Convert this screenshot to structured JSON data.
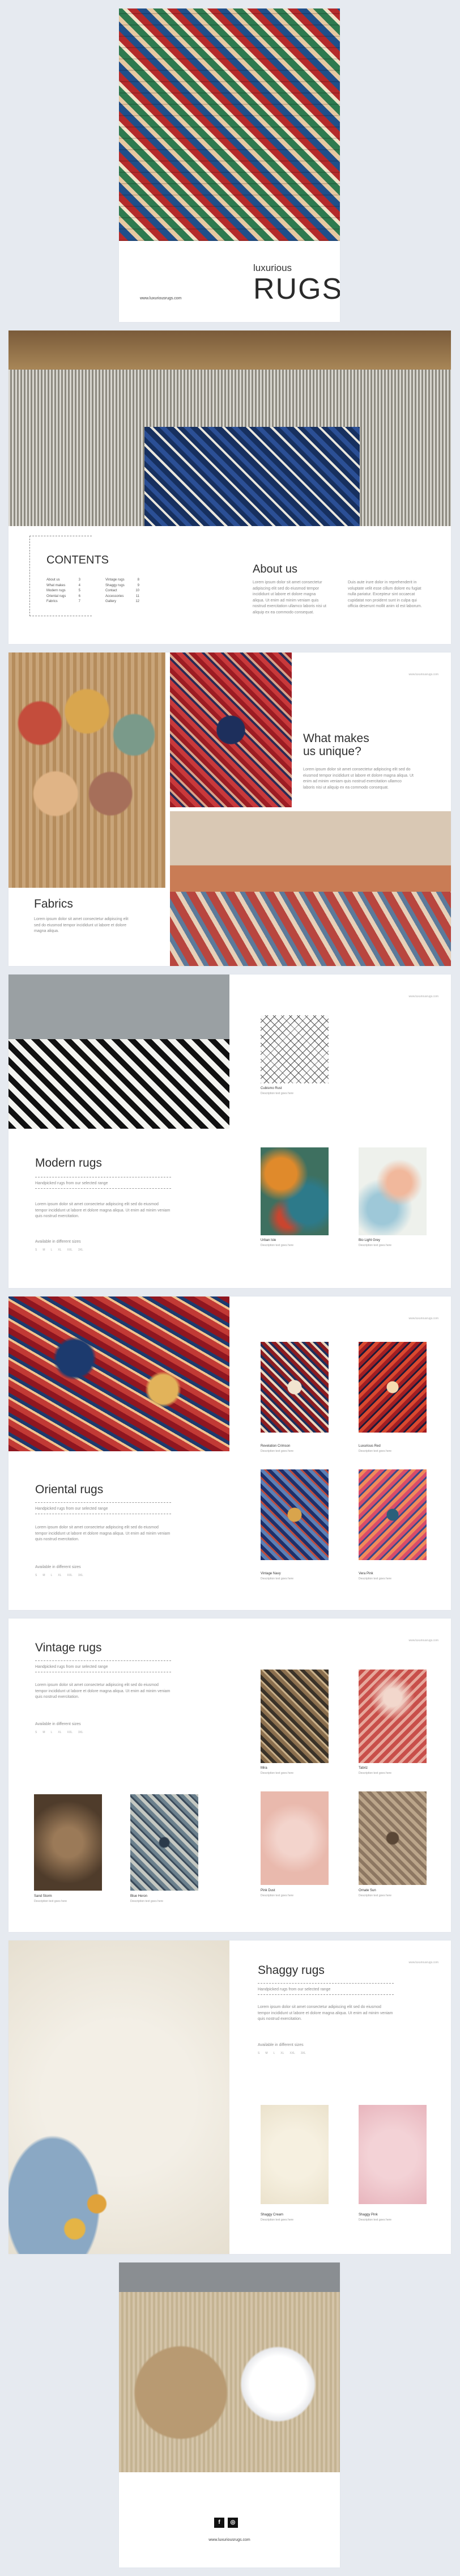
{
  "cover": {
    "title_small": "luxurious",
    "title_big": "RUGS",
    "website": "www.luxuriousrugs.com"
  },
  "contents": {
    "title": "CONTENTS",
    "col1": [
      {
        "label": "About us",
        "page": "3"
      },
      {
        "label": "What makes",
        "page": "4"
      },
      {
        "label": "Modern rugs",
        "page": "5"
      },
      {
        "label": "Oriental rugs",
        "page": "6"
      },
      {
        "label": "Fabrics",
        "page": "7"
      }
    ],
    "col2": [
      {
        "label": "Vintage rugs",
        "page": "8"
      },
      {
        "label": "Shaggy rugs",
        "page": "9"
      },
      {
        "label": "Contact",
        "page": "10"
      },
      {
        "label": "Accessories",
        "page": "11"
      },
      {
        "label": "Gallery",
        "page": "12"
      }
    ]
  },
  "about": {
    "title": "About us",
    "text1": "Lorem ipsum dolor sit amet consectetur adipiscing elit sed do eiusmod tempor incididunt ut labore et dolore magna aliqua. Ut enim ad minim veniam quis nostrud exercitation ullamco laboris nisi ut aliquip ex ea commodo consequat.",
    "text2": "Duis aute irure dolor in reprehenderit in voluptate velit esse cillum dolore eu fugiat nulla pariatur. Excepteur sint occaecat cupidatat non proident sunt in culpa qui officia deserunt mollit anim id est laborum."
  },
  "unique": {
    "title_line1": "What makes",
    "title_line2": "us unique?",
    "text": "Lorem ipsum dolor sit amet consectetur adipiscing elit sed do eiusmod tempor incididunt ut labore et dolore magna aliqua. Ut enim ad minim veniam quis nostrud exercitation ullamco laboris nisi ut aliquip ex ea commodo consequat.",
    "website": "www.luxuriousrugs.com"
  },
  "fabrics": {
    "title": "Fabrics",
    "text": "Lorem ipsum dolor sit amet consectetur adipiscing elit sed do eiusmod tempor incididunt ut labore et dolore magna aliqua."
  },
  "modern": {
    "title": "Modern rugs",
    "subtitle": "Handpicked rugs from our selected range",
    "text": "Lorem ipsum dolor sit amet consectetur adipiscing elit sed do eiusmod tempor incididunt ut labore et dolore magna aliqua. Ut enim ad minim veniam quis nostrud exercitation.",
    "sizes_label": "Available in different sizes",
    "sizes": [
      "S",
      "M",
      "L",
      "XL",
      "XXL",
      "3XL"
    ],
    "website": "www.luxuriousrugs.com",
    "items": [
      {
        "name": "Cubismo Rust",
        "sub": "Description text goes here"
      },
      {
        "name": "Urban Isle",
        "sub": "Description text goes here"
      },
      {
        "name": "Bio Light Grey",
        "sub": "Description text goes here"
      }
    ]
  },
  "oriental": {
    "title": "Oriental rugs",
    "subtitle": "Handpicked rugs from our selected range",
    "text": "Lorem ipsum dolor sit amet consectetur adipiscing elit sed do eiusmod tempor incididunt ut labore et dolore magna aliqua. Ut enim ad minim veniam quis nostrud exercitation.",
    "sizes_label": "Available in different sizes",
    "sizes": [
      "S",
      "M",
      "L",
      "XL",
      "XXL",
      "3XL"
    ],
    "website": "www.luxuriousrugs.com",
    "items": [
      {
        "name": "Revelation Crimson",
        "sub": "Description text goes here"
      },
      {
        "name": "Luxurious Red",
        "sub": "Description text goes here"
      },
      {
        "name": "Vintage Navy",
        "sub": "Description text goes here"
      },
      {
        "name": "Vera Pink",
        "sub": "Description text goes here"
      }
    ]
  },
  "vintage": {
    "title": "Vintage rugs",
    "subtitle": "Handpicked rugs from our selected range",
    "text": "Lorem ipsum dolor sit amet consectetur adipiscing elit sed do eiusmod tempor incididunt ut labore et dolore magna aliqua. Ut enim ad minim veniam quis nostrud exercitation.",
    "sizes_label": "Available in different sizes",
    "sizes": [
      "S",
      "M",
      "L",
      "XL",
      "XXL",
      "3XL"
    ],
    "website": "www.luxuriousrugs.com",
    "items": [
      {
        "name": "Mira",
        "sub": "Description text goes here"
      },
      {
        "name": "Tabriz",
        "sub": "Description text goes here"
      },
      {
        "name": "Pink Dust",
        "sub": "Description text goes here"
      },
      {
        "name": "Ornate Sun",
        "sub": "Description text goes here"
      },
      {
        "name": "Sand Storm",
        "sub": "Description text goes here"
      },
      {
        "name": "Blue Heron",
        "sub": "Description text goes here"
      }
    ]
  },
  "shaggy": {
    "title": "Shaggy rugs",
    "subtitle": "Handpicked rugs from our selected range",
    "text": "Lorem ipsum dolor sit amet consectetur adipiscing elit sed do eiusmod tempor incididunt ut labore et dolore magna aliqua. Ut enim ad minim veniam quis nostrud exercitation.",
    "sizes_label": "Available in different sizes",
    "sizes": [
      "S",
      "M",
      "L",
      "XL",
      "XXL",
      "3XL"
    ],
    "website": "www.luxuriousrugs.com",
    "items": [
      {
        "name": "Shaggy Cream",
        "sub": "Description text goes here"
      },
      {
        "name": "Shaggy Pink",
        "sub": "Description text goes here"
      }
    ]
  },
  "back": {
    "facebook": "f",
    "instagram": "◎",
    "website": "www.luxuriousrugs.com"
  }
}
